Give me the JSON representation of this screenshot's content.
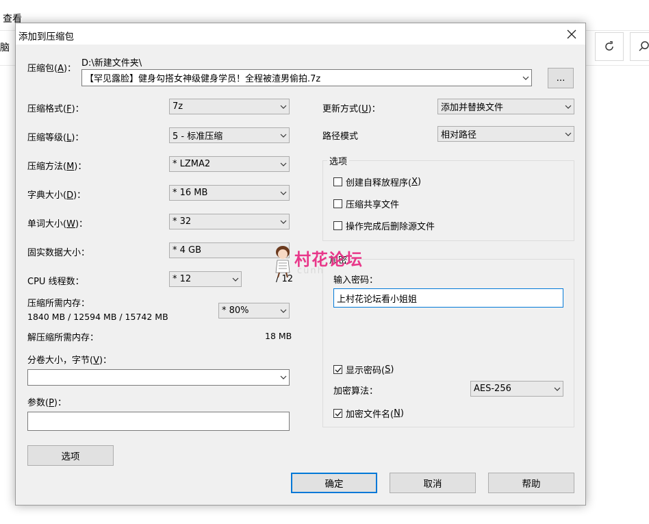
{
  "background": {
    "menu_view": "查看",
    "address_partial": "脑"
  },
  "dialog": {
    "title": "添加到压缩包",
    "archive": {
      "label_prefix": "压缩包(",
      "label_key": "A",
      "label_suffix": ")：",
      "path": "D:\\新建文件夹\\",
      "filename": "【罕见露脸】健身勾搭女神级健身学员！全程被渣男偷拍.7z",
      "browse_label": "..."
    },
    "left": {
      "format": {
        "label_prefix": "压缩格式(",
        "key": "F",
        "label_suffix": ")：",
        "value": "7z"
      },
      "level": {
        "label_prefix": "压缩等级(",
        "key": "L",
        "label_suffix": ")：",
        "value": "5 - 标准压缩"
      },
      "method": {
        "label_prefix": "压缩方法(",
        "key": "M",
        "label_suffix": ")：",
        "value": "* LZMA2"
      },
      "dict": {
        "label_prefix": "字典大小(",
        "key": "D",
        "label_suffix": ")：",
        "value": "* 16 MB"
      },
      "word": {
        "label_prefix": "单词大小(",
        "key": "W",
        "label_suffix": ")：",
        "value": "* 32"
      },
      "solid": {
        "label": "固实数据大小：",
        "value": "* 4 GB"
      },
      "threads": {
        "label": "CPU 线程数：",
        "value": "* 12",
        "max": "/ 12"
      },
      "mem_compress": {
        "label": "压缩所需内存：",
        "detail": "1840 MB / 12594 MB / 15742 MB",
        "value": "* 80%"
      },
      "mem_decompress": {
        "label": "解压缩所需内存：",
        "value": "18 MB"
      },
      "volume": {
        "label_prefix": "分卷大小，字节(",
        "key": "V",
        "label_suffix": ")：",
        "value": ""
      },
      "params": {
        "label_prefix": "参数(",
        "key": "P",
        "label_suffix": ")：",
        "value": ""
      },
      "options_button": "选项"
    },
    "right": {
      "update": {
        "label_prefix": "更新方式(",
        "key": "U",
        "label_suffix": ")：",
        "value": "添加并替换文件"
      },
      "path_mode": {
        "label": "路径模式",
        "value": "相对路径"
      },
      "options_group": {
        "title": "选项",
        "sfx": {
          "label_prefix": "创建自释放程序(",
          "key": "X",
          "label_suffix": ")",
          "checked": false
        },
        "shared": {
          "label": "压缩共享文件",
          "checked": false
        },
        "delete": {
          "label": "操作完成后删除源文件",
          "checked": false
        }
      },
      "encryption_group": {
        "title": "加密",
        "password_label": "输入密码：",
        "password_value": "上村花论坛看小姐姐",
        "show_password": {
          "label_prefix": "显示密码(",
          "key": "S",
          "label_suffix": ")",
          "checked": true
        },
        "algorithm_label": "加密算法：",
        "algorithm_value": "AES-256",
        "encrypt_names": {
          "label_prefix": "加密文件名(",
          "key": "N",
          "label_suffix": ")",
          "checked": true
        }
      }
    },
    "buttons": {
      "ok": "确定",
      "cancel": "取消",
      "help": "帮助"
    }
  },
  "watermark": {
    "text": "村花论坛",
    "subtext": "cunh"
  }
}
